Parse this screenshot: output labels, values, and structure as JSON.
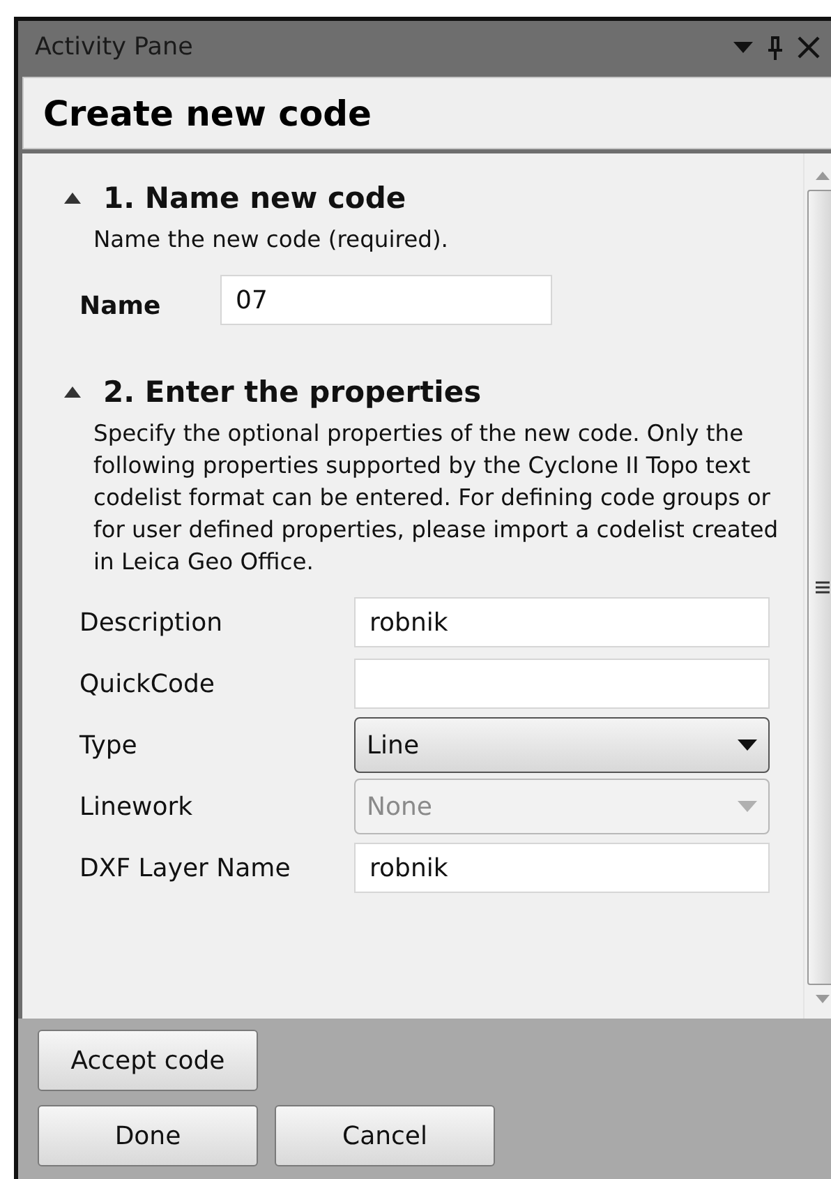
{
  "window": {
    "title": "Activity Pane"
  },
  "header": "Create new code",
  "sections": [
    {
      "title": "1. Name new code",
      "expanded": true,
      "intro": "Name the new code (required).",
      "fields": [
        {
          "kind": "text",
          "label": "Name",
          "value": "07"
        }
      ]
    },
    {
      "title": "2. Enter the properties",
      "expanded": true,
      "intro": "Specify the optional properties of the new code. Only the following properties supported by the Cyclone II Topo text codelist format can be entered. For defining code groups or for user defined properties, please import a codelist created in Leica Geo Office.",
      "fields": [
        {
          "kind": "text",
          "label": "Description",
          "value": "robnik"
        },
        {
          "kind": "text",
          "label": "QuickCode"
        },
        {
          "kind": "dropdown",
          "label": "Type",
          "value": "Line",
          "disabled": false
        },
        {
          "kind": "dropdown",
          "label": "Linework",
          "value": "None",
          "disabled": true
        },
        {
          "kind": "text",
          "label": "DXF Layer Name",
          "value": "robnik"
        }
      ]
    }
  ],
  "buttons": [
    [
      "Accept code"
    ],
    [
      "Done",
      "Cancel"
    ]
  ]
}
